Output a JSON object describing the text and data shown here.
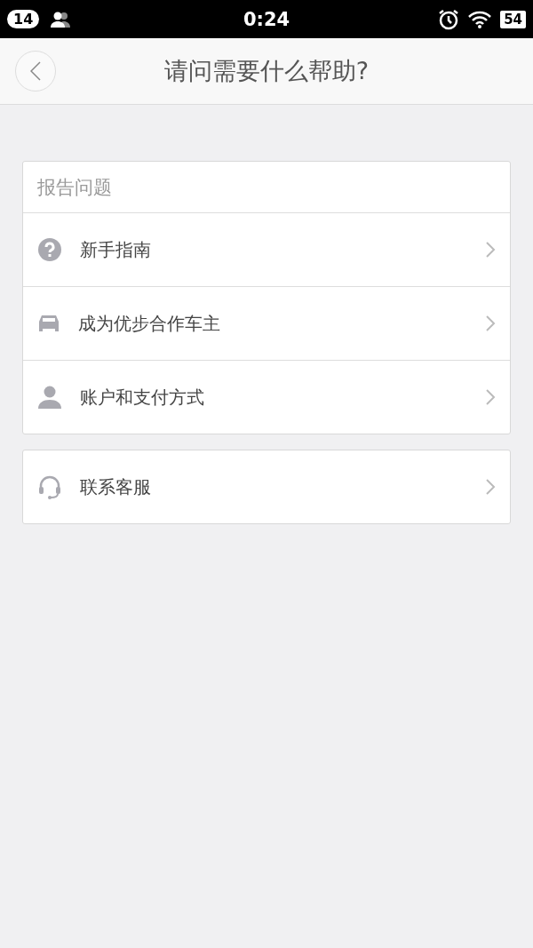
{
  "status_bar": {
    "notification_count": "14",
    "time": "0:24",
    "battery": "54"
  },
  "header": {
    "title": "请问需要什么帮助?"
  },
  "sections": [
    {
      "title": "报告问题",
      "items": [
        {
          "label": "新手指南",
          "kind": "question"
        },
        {
          "label": "成为优步合作车主",
          "kind": "car"
        },
        {
          "label": "账户和支付方式",
          "kind": "person"
        }
      ]
    },
    {
      "items": [
        {
          "label": "联系客服",
          "kind": "headset"
        }
      ]
    }
  ]
}
